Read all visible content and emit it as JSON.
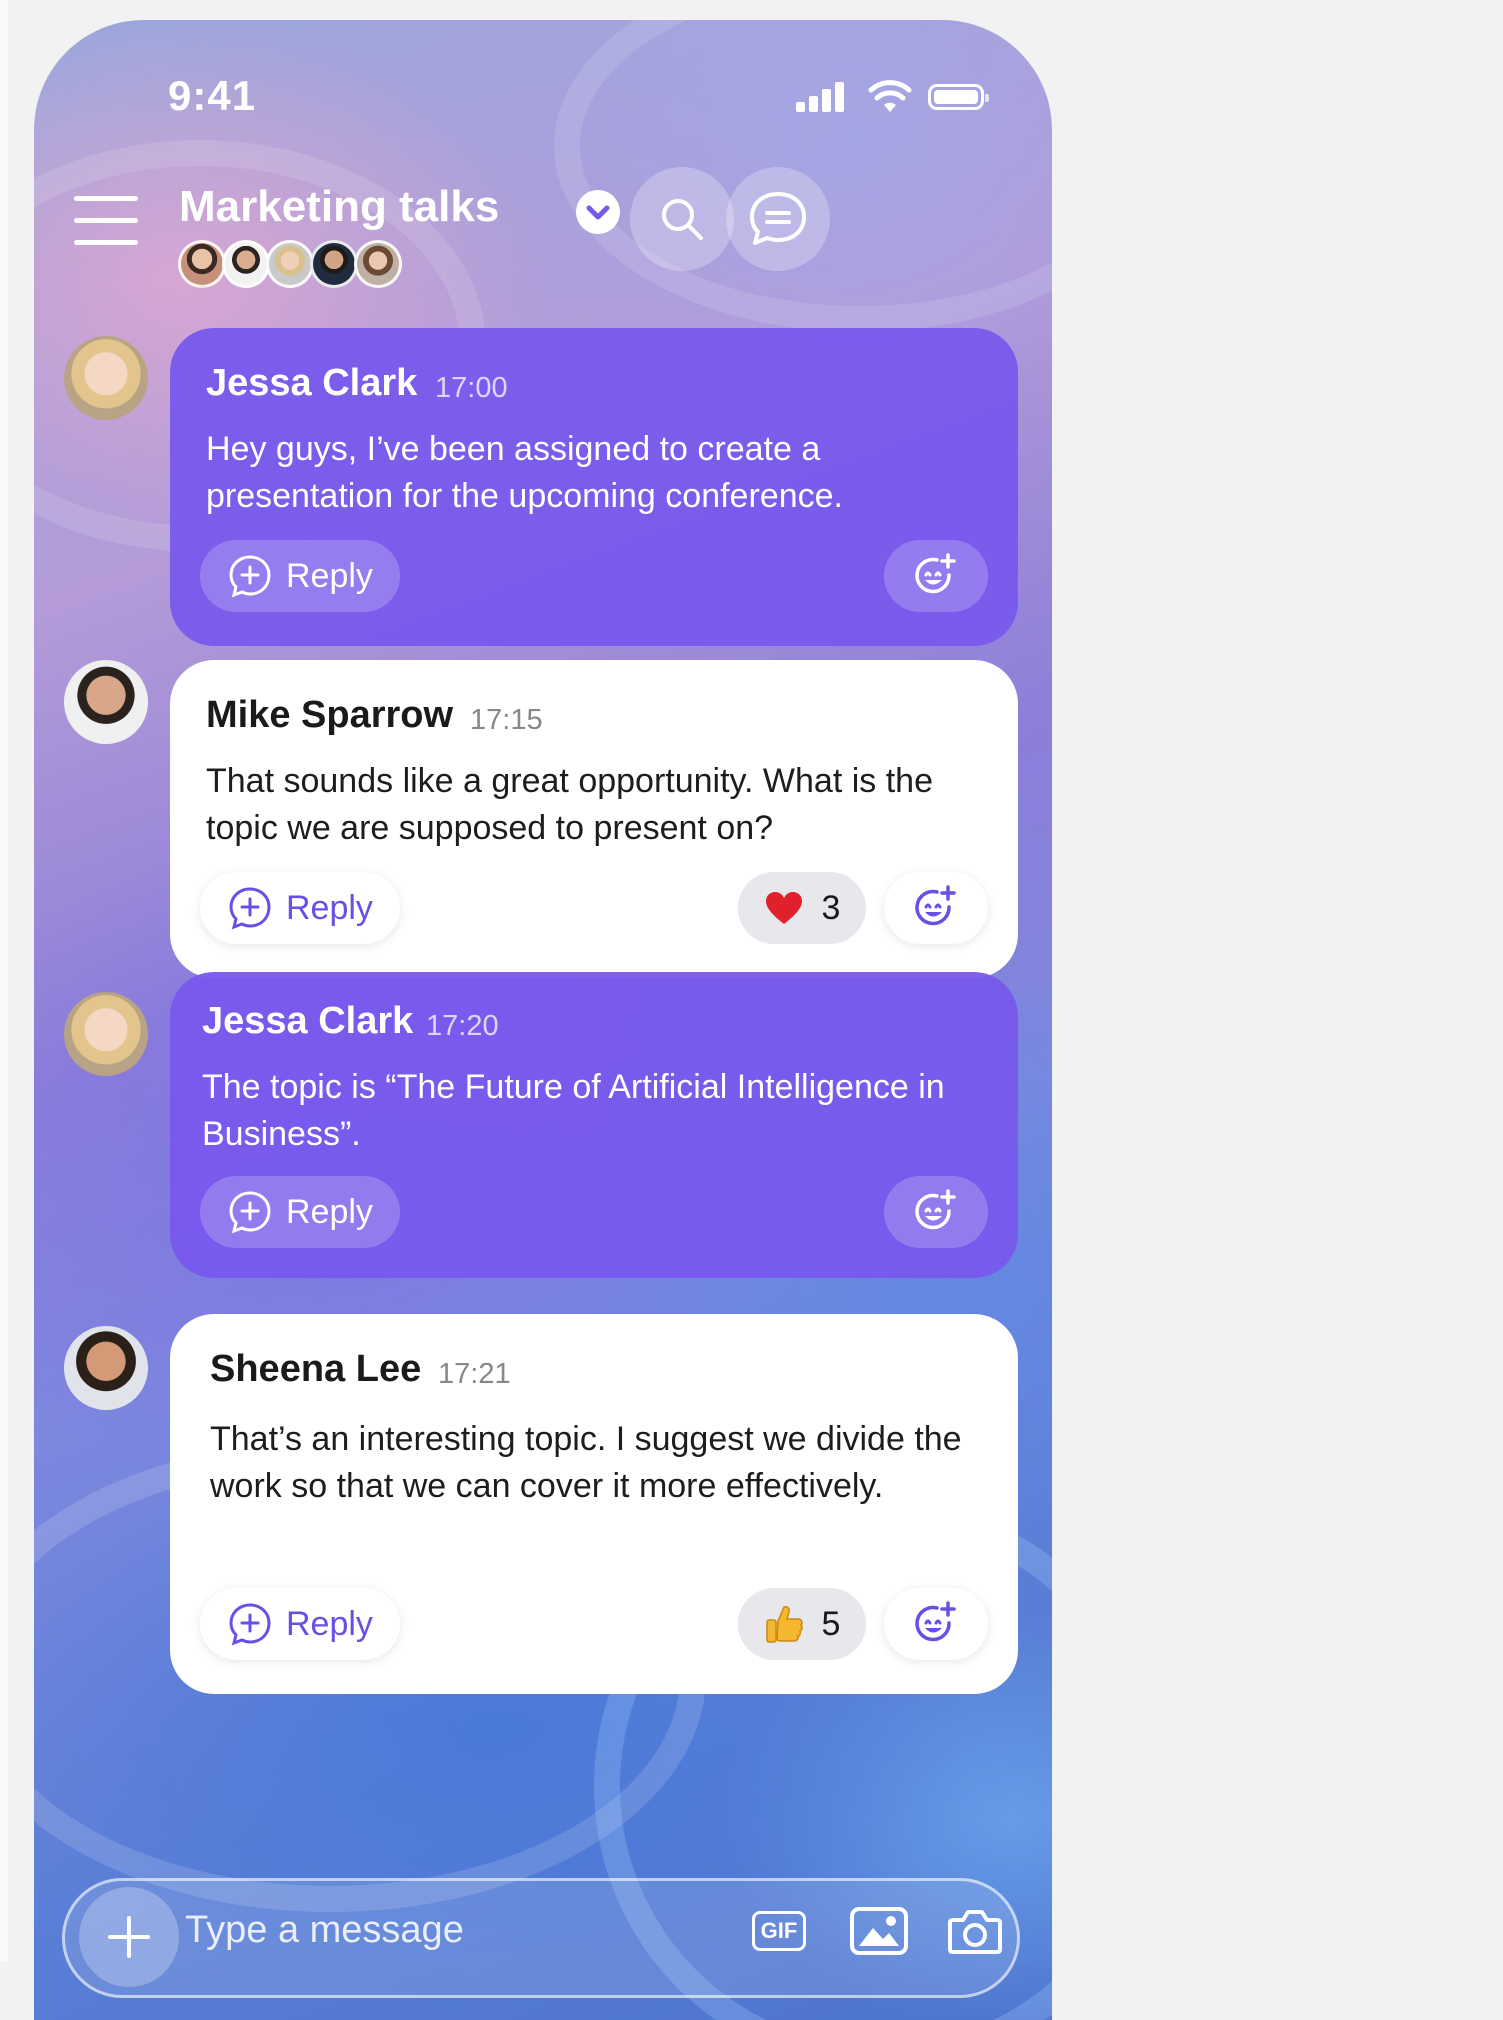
{
  "status_bar": {
    "time": "9:41"
  },
  "header": {
    "title": "Marketing talks",
    "member_count": 5
  },
  "messages": [
    {
      "author": "Jessa Clark",
      "time": "17:00",
      "text": "Hey guys, I’ve been assigned to create a presentation for the upcoming conference.",
      "style": "purple",
      "reply_label": "Reply",
      "reaction": null
    },
    {
      "author": "Mike Sparrow",
      "time": "17:15",
      "text": "That sounds like a great opportunity. What is the topic we are supposed to present on?",
      "style": "white",
      "reply_label": "Reply",
      "reaction": {
        "emoji": "heart",
        "count": "3"
      }
    },
    {
      "author": "Jessa Clark",
      "time": "17:20",
      "text": "The topic is “The Future of Artificial Intelligence in Business”.",
      "style": "purple",
      "reply_label": "Reply",
      "reaction": null
    },
    {
      "author": "Sheena Lee",
      "time": "17:21",
      "text": "That’s an interesting topic. I suggest we divide the work so that we can cover it more effectively.",
      "style": "white",
      "reply_label": "Reply",
      "reaction": {
        "emoji": "thumbs-up",
        "count": "5"
      }
    }
  ],
  "composer": {
    "placeholder": "Type a message",
    "gif_label": "GIF"
  },
  "colors": {
    "accent": "#7858ec",
    "reply_text": "#6a4ee6",
    "heart": "#e0202a",
    "thumb": "#f5b730"
  }
}
